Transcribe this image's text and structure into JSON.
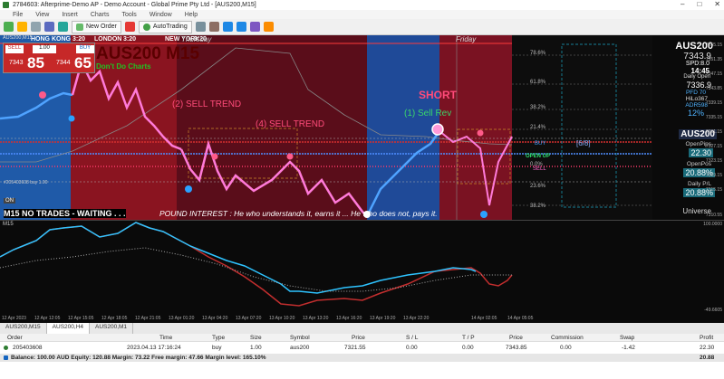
{
  "window": {
    "title": "2784603: Afterprime-Demo AP - Demo Account - Global Prime Pty Ltd - [AUS200,M15]",
    "controls": [
      "–",
      "□",
      "✕"
    ]
  },
  "menu": [
    "File",
    "View",
    "Insert",
    "Charts",
    "Tools",
    "Window",
    "Help"
  ],
  "toolbar": {
    "new_order": "New Order",
    "autotrading": "AutoTrading",
    "icons": [
      "new-chart-icon",
      "profiles-icon",
      "market-watch-icon",
      "navigator-icon",
      "terminal-icon",
      "tester-icon",
      "crosshair-icon",
      "line-icon",
      "zoom-in-icon",
      "zoom-out-icon",
      "period-icon",
      "template-icon"
    ]
  },
  "chart": {
    "symbol_label": "AUS200,M15",
    "sessions": [
      "HONG KONG",
      "LONDON",
      "NEW YORK"
    ],
    "session_times": [
      "3:20",
      "3:20",
      "3:20"
    ],
    "day_labels": [
      "Thursday",
      "Friday"
    ],
    "watermark": "AUS200 M15",
    "dont_do": "Don't Do Charts",
    "sell_label": "SELL",
    "buy_label": "BUY",
    "lot": "1.00",
    "sell_price_small": "7343",
    "sell_price_big": "85",
    "buy_price_small": "7344",
    "buy_price_big": "65",
    "annotations": {
      "sell_trend_2": "(2) SELL TREND",
      "sell_trend_4": "(4) SELL TREND",
      "short": "SHORT",
      "sell_rev": "(1) Sell Rev"
    },
    "status_line": "M15  NO TRADES - WAITING . . .",
    "quote": "POUND INTEREST : He who understands it, earns it ... He who does not, pays it.",
    "on_label": "ON",
    "position_label": "#205403608 buy 1.00",
    "fib_levels": [
      "78.6%",
      "61.8%",
      "38.2%",
      "21.4%",
      "0.0%",
      "23.6%",
      "38.2%"
    ],
    "zone_labels": [
      "BUY",
      "OPEN UP",
      "SELL"
    ],
    "fraction": "[6/8]",
    "price_axis": [
      "7355.15",
      "7351.35",
      "7347.15",
      "7343.85",
      "7339.15",
      "7335.15",
      "7331.15",
      "7327.15",
      "7323.15",
      "7319.15",
      "7315.15",
      "7310.55"
    ],
    "info": {
      "symbol": "AUS200",
      "bid": "7343.9",
      "spread": "SPD:8.0",
      "time": "14:45",
      "daily_open_label": "Daily Open",
      "daily_open": "7336.9",
      "pfd": "PFD 70",
      "hilo": "HiLo367",
      "adr": "ADR598",
      "pct": "12%",
      "ticker2": "AUS200",
      "open_pips_label": "OpenPips",
      "open_pips": "22.30",
      "open_pos_label": "OpenPos",
      "open_pos": "20.88%",
      "daily_pl_label": "Daily P/L",
      "daily_pl": "20.88%",
      "universe": "Universe"
    }
  },
  "oscillator": {
    "label": "M15",
    "axis": [
      "100.0000",
      "-49.6605"
    ]
  },
  "time_axis": [
    "12 Apr 2023",
    "12 Apr 12:05",
    "12 Apr 15:05",
    "12 Apr 18:05",
    "12 Apr 21:05",
    "13 Apr 01:20",
    "13 Apr 04:20",
    "13 Apr 07:20",
    "13 Apr 10:20",
    "13 Apr 13:20",
    "13 Apr 16:20",
    "13 Apr 19:20",
    "13 Apr 22:20",
    "14 Apr 02:05",
    "14 Apr 05:05"
  ],
  "tabs": [
    "AUS200,M15",
    "AUS200,H4",
    "AUS200,M1"
  ],
  "trade_table": {
    "headers": [
      "Order",
      "Time",
      "Type",
      "Size",
      "Symbol",
      "Price",
      "S / L",
      "T / P",
      "Price",
      "Commission",
      "Swap",
      "Profit"
    ],
    "row": [
      "205403608",
      "2023.04.13 17:16:24",
      "buy",
      "1.00",
      "aus200",
      "7321.55",
      "0.00",
      "0.00",
      "7343.85",
      "0.00",
      "-1.42",
      "22.30"
    ],
    "balance": "Balance: 100.00 AUD  Equity: 120.88  Margin: 73.22  Free margin: 47.66  Margin level: 165.10%",
    "balance_profit": "20.88"
  }
}
